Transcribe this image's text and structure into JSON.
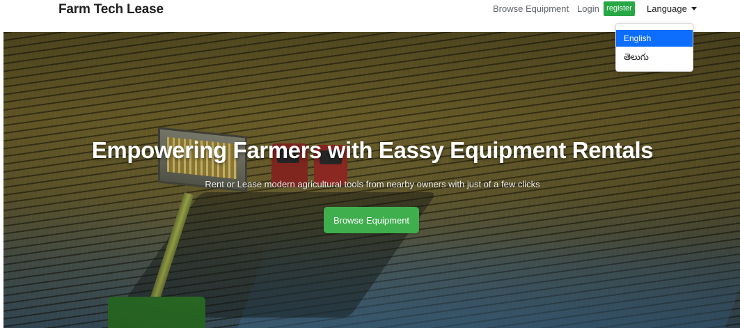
{
  "navbar": {
    "brand": "Farm Tech Lease",
    "links": {
      "browse": "Browse Equipment",
      "login": "Login",
      "register": "register",
      "language": "Language"
    }
  },
  "language_dropdown": {
    "options": [
      "English",
      "తెలుగు"
    ],
    "selected": "English",
    "selected_color": "#0d6efd"
  },
  "hero": {
    "title": "Empowering Farmers with Eassy Equipment Rentals",
    "subtitle": "Rent or Lease modern agricultural tools from nearby owners with just of a few clicks",
    "cta_label": "Browse Equipment",
    "cta_color": "#3fae4d"
  },
  "colors": {
    "register_button": "#28a745",
    "nav_text": "#5f6368"
  },
  "icons": {
    "language_toggle": "caret-down-icon"
  }
}
